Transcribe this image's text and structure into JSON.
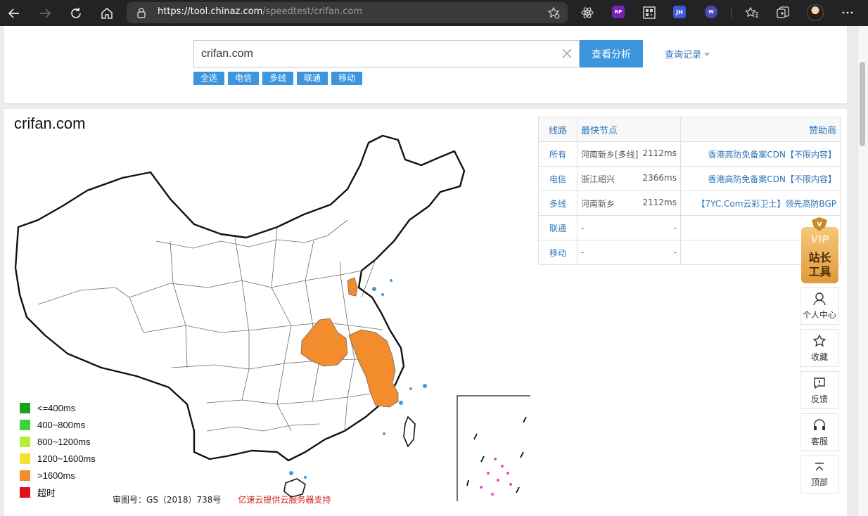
{
  "browser": {
    "url_host": "https://tool.chinaz.com",
    "url_path": "/speedtest/crifan.com",
    "extensions": [
      {
        "name": "react-devtools-icon",
        "label": ""
      },
      {
        "name": "rp-extension-icon",
        "label": "RP"
      },
      {
        "name": "qr-code-icon",
        "label": ""
      },
      {
        "name": "jh-extension-icon",
        "label": "JH"
      },
      {
        "name": "w-extension-icon",
        "label": "W"
      }
    ]
  },
  "search": {
    "value": "crifan.com",
    "button_label": "查看分析",
    "history_label": "查询记录",
    "filters": [
      "全选",
      "电信",
      "多线",
      "联通",
      "移动"
    ]
  },
  "result": {
    "domain_title": "crifan.com",
    "table": {
      "headers": {
        "line": "线路",
        "node": "最快节点",
        "sponsor": "赞助商"
      },
      "rows": [
        {
          "line": "所有",
          "node": "河南新乡[多线]",
          "time": "2112ms",
          "sponsor": "香港高防免备案CDN【不限内容】"
        },
        {
          "line": "电信",
          "node": "浙江绍兴",
          "time": "2366ms",
          "sponsor": "香港高防免备案CDN【不限内容】"
        },
        {
          "line": "多线",
          "node": "河南新乡",
          "time": "2112ms",
          "sponsor": "【7YC.Com云彩卫士】领先高防BGP"
        },
        {
          "line": "联通",
          "node": "-",
          "time": "-",
          "sponsor": ""
        },
        {
          "line": "移动",
          "node": "-",
          "time": "-",
          "sponsor": ""
        }
      ]
    },
    "legend": [
      {
        "label": "<=400ms",
        "color": "#1e9e1e"
      },
      {
        "label": "400~800ms",
        "color": "#3bd23b"
      },
      {
        "label": "800~1200ms",
        "color": "#b5ee3a"
      },
      {
        "label": "1200~1600ms",
        "color": "#f2e233"
      },
      {
        "label": ">1600ms",
        "color": "#f28c2c"
      },
      {
        "label": "超时",
        "color": "#e0101a"
      }
    ],
    "map_highlight_color": "#f28c2c",
    "footnote": "审图号：GS（2018）738号",
    "support_text": "亿速云提供云服务器支持"
  },
  "side_tools": {
    "vip_line1": "VIP",
    "vip_line2": "站长",
    "vip_line3": "工具",
    "items": [
      {
        "name": "user-icon",
        "label": "个人中心"
      },
      {
        "name": "star-icon",
        "label": "收藏"
      },
      {
        "name": "feedback-icon",
        "label": "反馈"
      },
      {
        "name": "headset-icon",
        "label": "客服"
      },
      {
        "name": "top-icon",
        "label": "顶部"
      }
    ]
  }
}
